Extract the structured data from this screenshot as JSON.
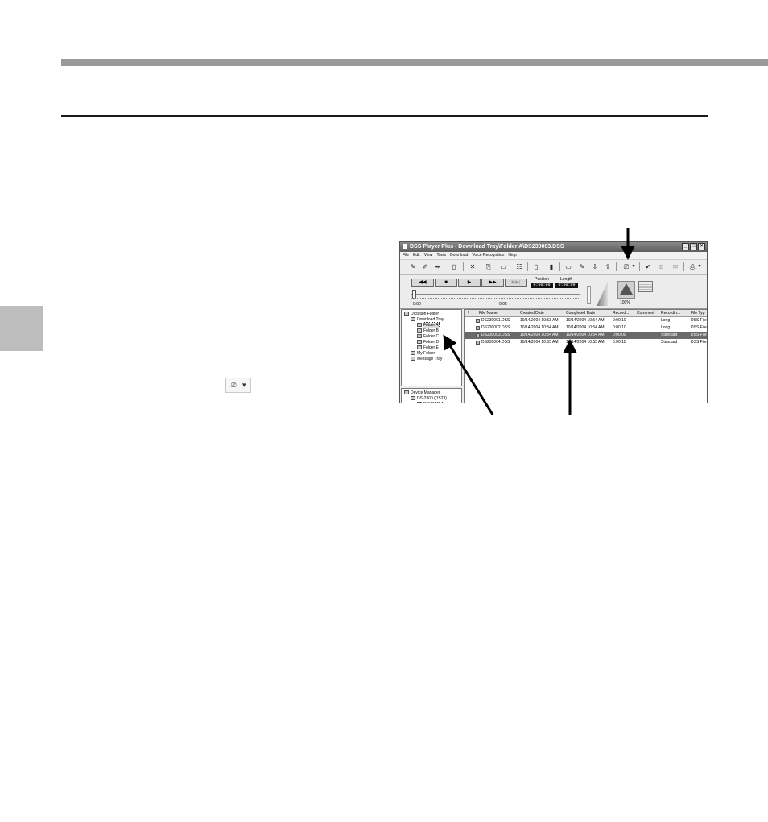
{
  "app": {
    "title": "DSS Player Plus - Download Tray\\Folder A\\DS230003.DSS",
    "window_buttons": [
      "_",
      "□",
      "×"
    ]
  },
  "menu": [
    "File",
    "Edit",
    "View",
    "Tools",
    "Download",
    "Voice Recognition",
    "Help"
  ],
  "toolbar_icons": [
    "record-icon",
    "edit-icon",
    "insert-icon",
    "send-icon",
    "delete-icon",
    "import-icon",
    "export-icon",
    "properties-icon",
    "split-icon",
    "join-icon",
    "folder-icon",
    "rename-icon",
    "download-icon",
    "upload-icon",
    "voice-recognition-icon",
    "dropdown-icon",
    "check-icon",
    "cancel-check-icon",
    "mail-icon",
    "print-icon"
  ],
  "transport": {
    "rewind": "◀◀",
    "stop": "■",
    "play": "▶",
    "fast_forward": "▶▶",
    "next": "▶▶|",
    "position_label": "Position",
    "position_value": "0:00:00",
    "length_label": "Length",
    "length_value": "0:00:09",
    "start_time": "0:00",
    "mid_time": "0:05",
    "speed_label": "100%"
  },
  "tree": {
    "items": [
      {
        "label": "Dictation Folder",
        "level": 0
      },
      {
        "label": "Download Tray",
        "level": 1
      },
      {
        "label": "Folder A",
        "level": 2,
        "selected": true
      },
      {
        "label": "Folder B",
        "level": 2
      },
      {
        "label": "Folder C",
        "level": 2
      },
      {
        "label": "Folder D",
        "level": 2
      },
      {
        "label": "Folder E",
        "level": 2
      },
      {
        "label": "My Folder",
        "level": 1
      },
      {
        "label": "Message Tray",
        "level": 1
      }
    ],
    "device_items": [
      {
        "label": "Device Manager",
        "level": 0
      },
      {
        "label": "DS-2300 (DS23)",
        "level": 1
      },
      {
        "label": "POLDER A",
        "level": 2
      }
    ]
  },
  "file_list": {
    "columns": [
      "!",
      "File Name",
      "Created Date",
      "Completed Date",
      "Record...",
      "Comment",
      "Recordin...",
      "File Typ"
    ],
    "rows": [
      [
        "DS230001.DSS",
        "10/14/2004 10:53 AM",
        "10/14/2004 10:54 AM",
        "0:00:10",
        "",
        "Long",
        "DSS File"
      ],
      [
        "DS230002.DSS",
        "10/14/2004 10:54 AM",
        "10/14/2004 10:54 AM",
        "0:00:10",
        "",
        "Long",
        "DSS File"
      ],
      [
        "DS230003.DSS",
        "10/14/2004 10:54 AM",
        "10/14/2004 10:54 AM",
        "0:00:09",
        "",
        "Standard",
        "DSS File"
      ],
      [
        "DS230004.DSS",
        "10/14/2004 10:55 AM",
        "10/14/2004 10:55 AM",
        "0:00:11",
        "",
        "Standard",
        "DSS File"
      ]
    ],
    "selected_row": 2
  },
  "page": {
    "inline_button_icon": "voice-recognition-icon",
    "inline_button_glyph": "▾"
  }
}
